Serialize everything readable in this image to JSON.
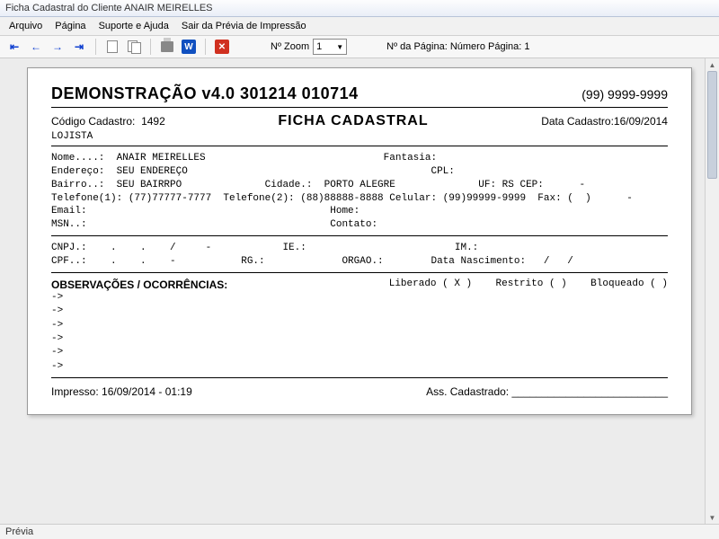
{
  "window_title": "Ficha Cadastral do Cliente  ANAIR MEIRELLES",
  "menu": {
    "arquivo": "Arquivo",
    "pagina": "Página",
    "suporte": "Suporte e Ajuda",
    "sair": "Sair da Prévia de Impressão"
  },
  "toolbar": {
    "zoom_label": "Nº Zoom",
    "zoom_value": "1",
    "page_label": "Nº da Página:",
    "page_value": "Número Página: 1"
  },
  "report": {
    "title": "DEMONSTRAÇÃO v4.0 301214 010714",
    "phone": "(99) 9999-9999",
    "codigo_label": "Código Cadastro:",
    "codigo_value": "1492",
    "ficha": "FICHA CADASTRAL",
    "data_label": "Data Cadastro:",
    "data_value": "16/09/2014",
    "lojista": "LOJISTA",
    "line_nome": "Nome....:  ANAIR MEIRELLES                              Fantasia:",
    "line_end": "Endereço:  SEU ENDEREÇO                                         CPL:",
    "line_bairro": "Bairro..:  SEU BAIRRPO              Cidade.:  PORTO ALEGRE              UF: RS CEP:      -",
    "line_tel": "Telefone(1): (77)77777-7777  Telefone(2): (88)88888-8888 Celular: (99)99999-9999  Fax: (  )      -",
    "line_email": "Email:                                         Home:",
    "line_msn": "MSN..:                                         Contato:",
    "line_cnpj": "CNPJ.:    .    .    /     -            IE.:                         IM.:",
    "line_cpf": "CPF..:    .    .    -           RG.:             ORGAO.:        Data Nascimento:   /   /",
    "obs_title": "OBSERVAÇÕES / OCORRÊNCIAS:",
    "flag_lib": "Liberado ( X )",
    "flag_res": "Restrito (   )",
    "flag_blo": "Bloqueado (   )",
    "arrow": "->",
    "impresso_label": "Impresso:",
    "impresso_value": "16/09/2014 - 01:19",
    "ass_label": "Ass. Cadastrado:",
    "ass_line": "__________________________"
  },
  "statusbar": "Prévia"
}
